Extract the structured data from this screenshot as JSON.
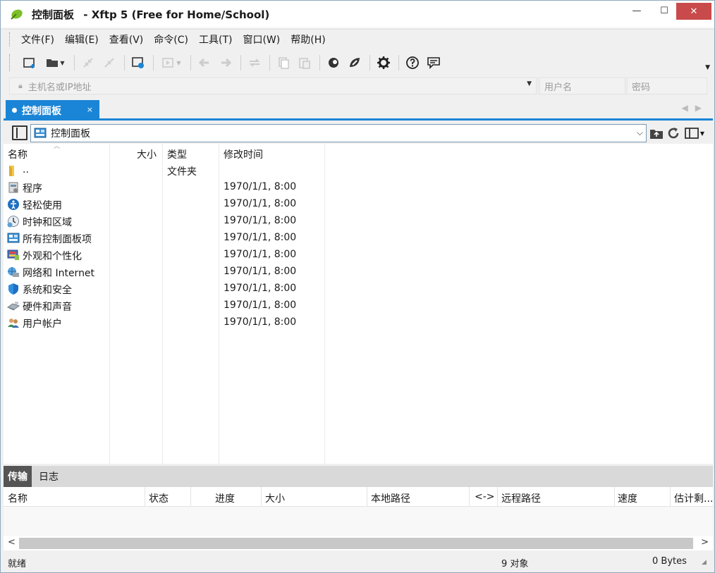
{
  "window": {
    "title_main": "控制面板",
    "title_app": "- Xftp 5 (Free for Home/School)",
    "btn_min": "—",
    "btn_max": "☐",
    "btn_close": "✕"
  },
  "menu": [
    {
      "label": "文件(F)"
    },
    {
      "label": "编辑(E)"
    },
    {
      "label": "查看(V)"
    },
    {
      "label": "命令(C)"
    },
    {
      "label": "工具(T)"
    },
    {
      "label": "窗口(W)"
    },
    {
      "label": "帮助(H)"
    }
  ],
  "address": {
    "host_placeholder": "主机名或IP地址",
    "user_placeholder": "用户名",
    "password_placeholder": "密码"
  },
  "tab": {
    "label": "控制面板",
    "close": "×"
  },
  "path": {
    "value": "控制面板"
  },
  "columns": {
    "name": "名称",
    "size": "大小",
    "type": "类型",
    "modified": "修改时间"
  },
  "files": [
    {
      "name": "..",
      "type": "文件夹",
      "modified": "",
      "icon": "folder-up-icon"
    },
    {
      "name": "程序",
      "type": "",
      "modified": "1970/1/1, 8:00",
      "icon": "programs-icon"
    },
    {
      "name": "轻松使用",
      "type": "",
      "modified": "1970/1/1, 8:00",
      "icon": "ease-of-access-icon"
    },
    {
      "name": "时钟和区域",
      "type": "",
      "modified": "1970/1/1, 8:00",
      "icon": "clock-region-icon"
    },
    {
      "name": "所有控制面板项",
      "type": "",
      "modified": "1970/1/1, 8:00",
      "icon": "control-panel-items-icon"
    },
    {
      "name": "外观和个性化",
      "type": "",
      "modified": "1970/1/1, 8:00",
      "icon": "appearance-icon"
    },
    {
      "name": "网络和 Internet",
      "type": "",
      "modified": "1970/1/1, 8:00",
      "icon": "network-icon"
    },
    {
      "name": "系统和安全",
      "type": "",
      "modified": "1970/1/1, 8:00",
      "icon": "system-security-icon"
    },
    {
      "name": "硬件和声音",
      "type": "",
      "modified": "1970/1/1, 8:00",
      "icon": "hardware-sound-icon"
    },
    {
      "name": "用户帐户",
      "type": "",
      "modified": "1970/1/1, 8:00",
      "icon": "user-accounts-icon"
    }
  ],
  "transfer": {
    "tab_transfer": "传输",
    "tab_log": "日志",
    "columns": [
      "名称",
      "状态",
      "进度",
      "大小",
      "本地路径",
      "<->",
      "远程路径",
      "速度",
      "估计剩..."
    ]
  },
  "status": {
    "ready": "就绪",
    "objects": "9 对象",
    "bytes": "0 Bytes"
  },
  "colors": {
    "accent": "#1a85d6",
    "close_button": "#c94a4a"
  }
}
